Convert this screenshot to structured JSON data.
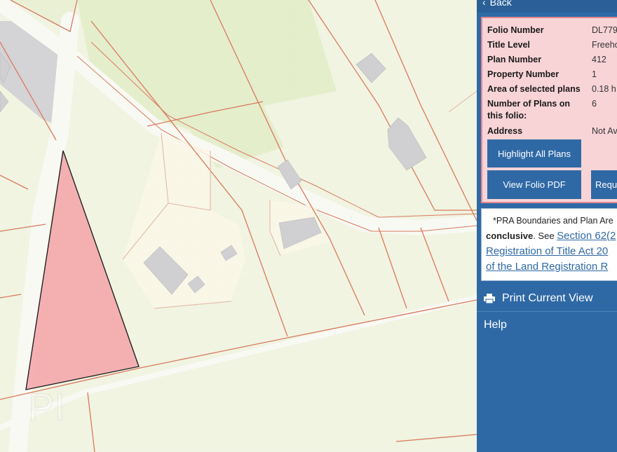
{
  "sidebar": {
    "back_label": "Back",
    "info": {
      "rows": [
        {
          "label": "Folio Number",
          "value": "DL779"
        },
        {
          "label": "Title Level",
          "value": "Freeho"
        },
        {
          "label": "Plan Number",
          "value": "412"
        },
        {
          "label": "Property Number",
          "value": "1"
        },
        {
          "label": "Area of selected plans",
          "value": "0.18 h"
        },
        {
          "label": "Number of Plans on",
          "label2": "this folio:",
          "value": "6"
        },
        {
          "label": "Address",
          "value": "Not Av"
        }
      ],
      "buttons": {
        "highlight_all": "Highlight All Plans",
        "view_folio_pdf": "View Folio PDF",
        "request": "Requ"
      }
    },
    "notice": {
      "line1": "*PRA Boundaries and Plan Are",
      "strong": "conclusive",
      "see": ". See ",
      "link1": "Section 62(2",
      "link2": "Registration of Title Act 20",
      "link3": "of the Land Registration R"
    },
    "menu": {
      "print": "Print Current View",
      "help": "Help"
    }
  },
  "map": {
    "watermark": "PI",
    "colors": {
      "land": "#f1f4e1",
      "field_green": "#e8f0d2",
      "road": "#f8f8f3",
      "boundary": "#d9795d",
      "building": "#cfcfd1",
      "highlight_fill": "#f4a3a8",
      "highlight_stroke": "#222222"
    }
  }
}
